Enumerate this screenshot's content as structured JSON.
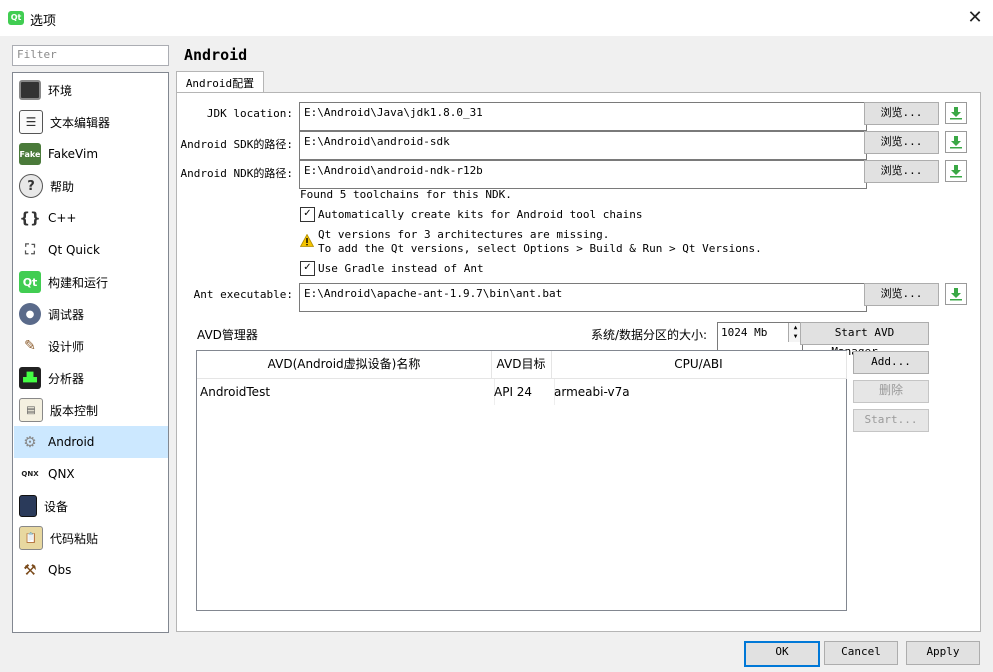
{
  "window": {
    "title": "选项",
    "icon_text": "Qt"
  },
  "sidebar": {
    "filter_placeholder": "Filter",
    "items": [
      {
        "label": "环境",
        "icon": "monitor-icon"
      },
      {
        "label": "文本编辑器",
        "icon": "text-editor-icon"
      },
      {
        "label": "FakeVim",
        "icon": "fakevim-icon"
      },
      {
        "label": "帮助",
        "icon": "help-icon"
      },
      {
        "label": "C++",
        "icon": "braces-icon"
      },
      {
        "label": "Qt Quick",
        "icon": "qt-quick-icon"
      },
      {
        "label": "构建和运行",
        "icon": "build-run-icon"
      },
      {
        "label": "调试器",
        "icon": "debugger-icon"
      },
      {
        "label": "设计师",
        "icon": "designer-icon"
      },
      {
        "label": "分析器",
        "icon": "analyzer-icon"
      },
      {
        "label": "版本控制",
        "icon": "version-control-icon"
      },
      {
        "label": "Android",
        "icon": "android-icon",
        "selected": true
      },
      {
        "label": "QNX",
        "icon": "qnx-icon"
      },
      {
        "label": "设备",
        "icon": "device-icon"
      },
      {
        "label": "代码粘贴",
        "icon": "code-paste-icon"
      },
      {
        "label": "Qbs",
        "icon": "hammer-icon"
      }
    ]
  },
  "main": {
    "heading": "Android",
    "tab_label": "Android配置",
    "jdk": {
      "label": "JDK location:",
      "value": "E:\\Android\\Java\\jdk1.8.0_31",
      "browse": "浏览..."
    },
    "sdk": {
      "label": "Android SDK的路径:",
      "value": "E:\\Android\\android-sdk",
      "browse": "浏览..."
    },
    "ndk": {
      "label": "Android NDK的路径:",
      "value": "E:\\Android\\android-ndk-r12b",
      "browse": "浏览..."
    },
    "toolchains_found": "Found 5 toolchains for this NDK.",
    "auto_kits": {
      "label": "Automatically create kits for Android tool chains",
      "checked": true
    },
    "warning_line1": "Qt versions for 3 architectures are missing.",
    "warning_line2": "To add the Qt versions, select Options > Build & Run > Qt Versions.",
    "gradle": {
      "label": "Use Gradle instead of Ant",
      "checked": true
    },
    "ant": {
      "label": "Ant executable:",
      "value": "E:\\Android\\apache-ant-1.9.7\\bin\\ant.bat",
      "browse": "浏览..."
    },
    "avd": {
      "title": "AVD管理器",
      "partition_label": "系统/数据分区的大小:",
      "partition_value": "1024 Mb",
      "start_manager": "Start AVD Manager...",
      "columns": [
        "AVD(Android虚拟设备)名称",
        "AVD目标",
        "CPU/ABI"
      ],
      "rows": [
        {
          "name": "AndroidTest",
          "target": "API 24",
          "abi": "armeabi-v7a"
        }
      ],
      "add": "Add...",
      "delete": "删除",
      "start": "Start..."
    }
  },
  "footer": {
    "ok": "OK",
    "cancel": "Cancel",
    "apply": "Apply"
  },
  "colors": {
    "selection": "#cce8ff",
    "accent": "#0078d7",
    "android_green": "#41cd52"
  }
}
